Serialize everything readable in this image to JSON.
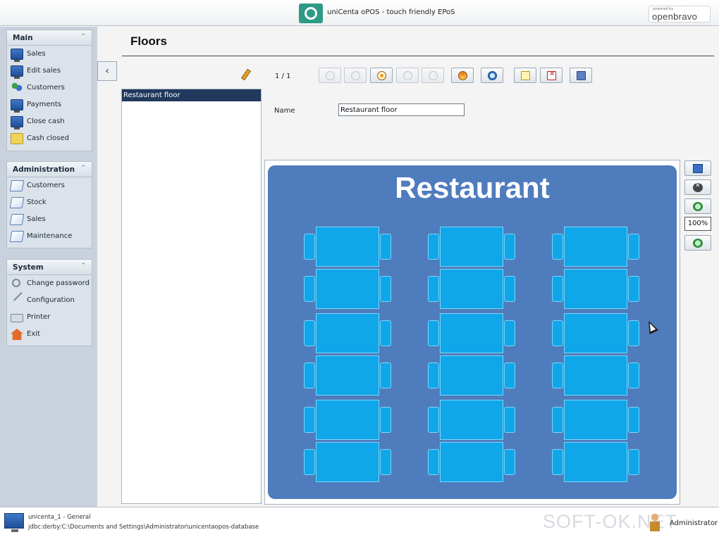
{
  "window": {
    "title": "uniCenta oPOS - touch friendly EPoS",
    "brand_small": "powered by",
    "brand_name": "openbravo"
  },
  "sidebar": {
    "main": {
      "title": "Main",
      "items": [
        {
          "label": "Sales",
          "icon": "monitor-icon"
        },
        {
          "label": "Edit sales",
          "icon": "monitor-icon"
        },
        {
          "label": "Customers",
          "icon": "people-icon"
        },
        {
          "label": "Payments",
          "icon": "monitor-icon"
        },
        {
          "label": "Close cash",
          "icon": "monitor-icon"
        },
        {
          "label": "Cash closed",
          "icon": "cash-icon"
        }
      ]
    },
    "administration": {
      "title": "Administration",
      "items": [
        {
          "label": "Customers",
          "icon": "document-icon"
        },
        {
          "label": "Stock",
          "icon": "document-icon"
        },
        {
          "label": "Sales",
          "icon": "document-icon"
        },
        {
          "label": "Maintenance",
          "icon": "document-icon"
        }
      ]
    },
    "system": {
      "title": "System",
      "items": [
        {
          "label": "Change password",
          "icon": "key-icon"
        },
        {
          "label": "Configuration",
          "icon": "tools-icon"
        },
        {
          "label": "Printer",
          "icon": "printer-icon"
        },
        {
          "label": "Exit",
          "icon": "home-icon"
        }
      ]
    }
  },
  "main": {
    "title": "Floors",
    "list": {
      "items": [
        "Restaurant floor"
      ]
    },
    "pager": "1 / 1",
    "form": {
      "name_label": "Name",
      "name_value": "Restaurant floor"
    },
    "floor": {
      "title": "Restaurant",
      "background": "#4f7cbd",
      "table_color": "#0fa7ea"
    },
    "zoom": "100%"
  },
  "status": {
    "line1": "unicenta_1 - General",
    "line2": "jdbc:derby:C:\\Documents and Settings\\Administrator\\unicentaopos-database",
    "user": "Administrator",
    "watermark": "SOFT-OK.NET"
  }
}
